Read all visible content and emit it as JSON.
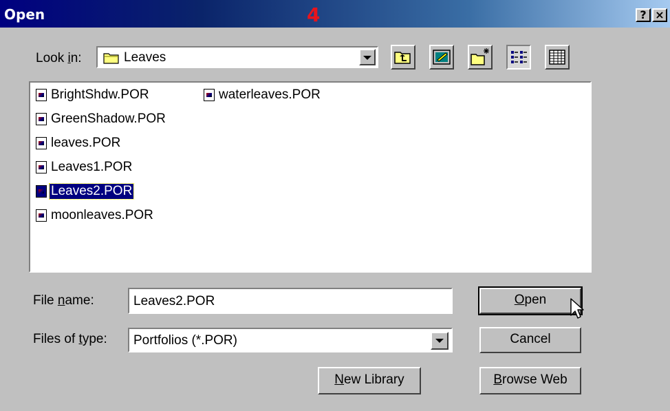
{
  "window": {
    "title": "Open",
    "step_number": "4",
    "help_button": "?",
    "close_button": "×"
  },
  "look_in": {
    "label_prefix": "Look ",
    "label_accel": "i",
    "label_suffix": "n:",
    "value": "Leaves"
  },
  "toolbar": {
    "icons": [
      "up-one-level-icon",
      "desktop-icon",
      "new-folder-icon",
      "list-view-icon",
      "details-view-icon"
    ]
  },
  "files": {
    "items": [
      "BrightShdw.POR",
      "GreenShadow.POR",
      "leaves.POR",
      "Leaves1.POR",
      "Leaves2.POR",
      "moonleaves.POR",
      "waterleaves.POR"
    ],
    "selected": "Leaves2.POR"
  },
  "file_name": {
    "label_prefix": "File ",
    "label_accel": "n",
    "label_suffix": "ame:",
    "value": "Leaves2.POR"
  },
  "file_type": {
    "label_prefix": "Files of ",
    "label_accel": "t",
    "label_suffix": "ype:",
    "value": "Portfolios (*.POR)"
  },
  "buttons": {
    "open_accel": "O",
    "open_rest": "pen",
    "cancel": "Cancel",
    "new_library_accel": "N",
    "new_library_rest": "ew Library",
    "browse_web_accel": "B",
    "browse_web_rest": "rowse Web"
  },
  "colors": {
    "title_start": "#000080",
    "title_end": "#a6caf0",
    "selection": "#000080",
    "step_number": "#e8141c"
  }
}
